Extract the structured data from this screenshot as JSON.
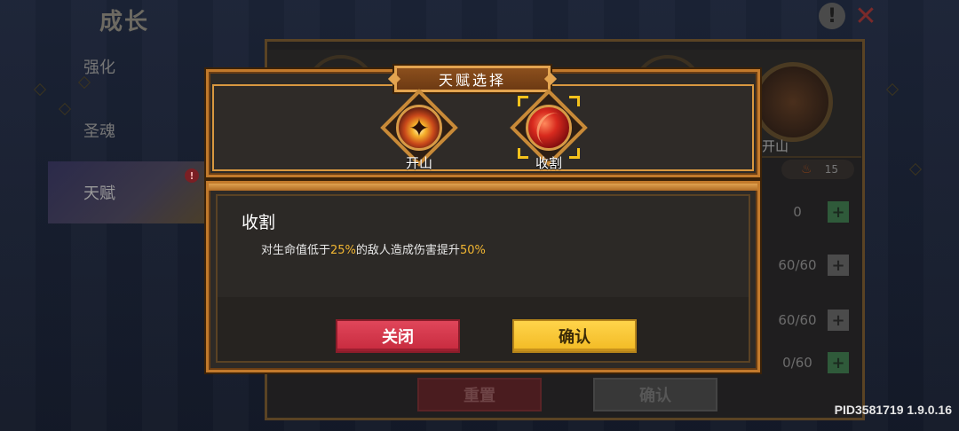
{
  "page": {
    "title": "成长"
  },
  "sidebar": {
    "items": [
      {
        "label": "强化"
      },
      {
        "label": "圣魂"
      },
      {
        "label": "天赋",
        "badge": "!"
      }
    ]
  },
  "background_panel": {
    "talent_label": "开山",
    "fire_count": "15",
    "rows": [
      {
        "value": "0"
      },
      {
        "value": "60/60"
      },
      {
        "value": "60/60"
      },
      {
        "value": "0/60"
      }
    ],
    "reset_label": "重置",
    "confirm_label": "确认"
  },
  "dialog": {
    "header": "天赋选择",
    "talents": [
      {
        "name": "开山",
        "icon": "mountain-burst-icon",
        "selected": false
      },
      {
        "name": "收割",
        "icon": "harvest-slash-icon",
        "selected": true
      }
    ],
    "detail": {
      "title": "收割",
      "desc_part1": "对生命值低于",
      "threshold": "25%",
      "desc_part2": "的敌人造成伤害提升",
      "bonus": "50%"
    },
    "close_label": "关闭",
    "confirm_label": "确认"
  },
  "version": "PID3581719 1.9.0.16",
  "colors": {
    "frame_gold": "#c27a2c",
    "highlight": "#f2b632",
    "close_red": "#c72a3e",
    "confirm_yellow": "#f2ba24"
  }
}
